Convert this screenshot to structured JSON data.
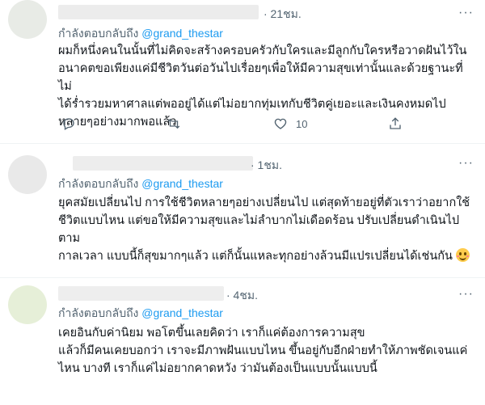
{
  "replies": [
    {
      "time": "· 21ชม.",
      "replying_prefix": "กำลังตอบกลับถึง",
      "replying_handle": "@grand_thestar",
      "text": "ผมก็หนึ่งคนในนั้นที่ไม่คิดจะสร้างครอบครัวกับใครและมีลูกกับใครหรือวาดฝันไว้ใน\nอนาคตขอเพียงแค่มีชีวิตวันต่อวันไปเรื่อยๆเพื่อให้มีความสุขเท่านั้นและด้วยฐานะที่ไม่\nได้ร่ำรวยมหาศาลแต่พออยู่ได้แต่ไม่อยากทุ่มเทกับชีวิตคู่เยอะและเงินคงหมดไป\nหลายๆอย่างมากพอแล้ว",
      "like_count": "10",
      "more_icon": "more-horizontal-icon",
      "avatar_color": "#e8ebe6"
    },
    {
      "time": "· 1ชม.",
      "replying_prefix": "กำลังตอบกลับถึง",
      "replying_handle": "@grand_thestar",
      "text": "ยุคสมัยเปลี่ยนไป การใช้ชีวิตหลายๆอย่างเปลี่ยนไป แต่สุดท้ายอยู่ที่ตัวเราว่าอยากใช้\nชีวิตแบบไหน แต่ขอให้มีความสุขและไม่ลำบากไม่เดือดร้อน ปรับเปลี่ยนดำเนินไปตาม\nกาลเวลา แบบนี้ก็สุขมากๆแล้ว แต่ก็นั้นแหละทุกอย่างล้วนมีแปรเปลี่ยนได้เช่นกัน",
      "emoji": "smiling-face-emoji",
      "more_icon": "more-horizontal-icon",
      "avatar_color": "#e9e9e9"
    },
    {
      "time": "· 4ชม.",
      "replying_prefix": "กำลังตอบกลับถึง",
      "replying_handle": "@grand_thestar",
      "text": "เคยอินกับค่านิยม พอโตขึ้นเลยคิดว่า เราก็แค่ต้องการความสุข\nแล้วก็มีคนเคยบอกว่า เราจะมีภาพฝันแบบไหน ขึ้นอยู่กับอีกฝ่ายทำให้ภาพชัดเจนแค่\nไหน บางที เราก็แค่ไม่อยากคาดหวัง ว่ามันต้องเป็นแบบนั้นแบบนี้",
      "more_icon": "more-horizontal-icon",
      "avatar_color": "#e6efd8"
    }
  ],
  "colors": {
    "link": "#1d9bf0",
    "muted": "#536471",
    "text": "#0f1419"
  }
}
